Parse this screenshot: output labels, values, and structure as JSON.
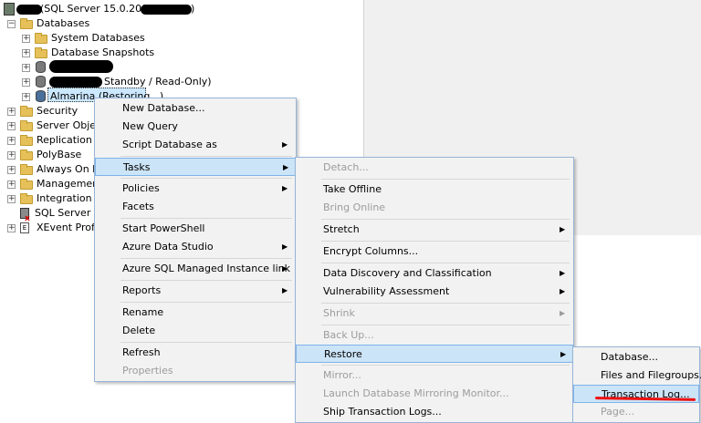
{
  "tree": {
    "server": {
      "prefix": "",
      "text": "(SQL Server 15.0.2000.5",
      "suffix": ")"
    },
    "databases": "Databases",
    "system_databases": "System Databases",
    "database_snapshots": "Database Snapshots",
    "standby_db_suffix": "Standby / Read-Only)",
    "restoring_db": "Almarina (Restoring...)",
    "security": "Security",
    "server_objects": "Server Objects",
    "replication": "Replication",
    "polybase": "PolyBase",
    "always_on": "Always On Hi",
    "management": "Management",
    "integration": "Integration Se",
    "agent": "SQL Server Ag",
    "xevent": "XEvent Profile"
  },
  "context_menu": {
    "new_database": "New Database...",
    "new_query": "New Query",
    "script_database_as": "Script Database as",
    "tasks": "Tasks",
    "policies": "Policies",
    "facets": "Facets",
    "start_powershell": "Start PowerShell",
    "azure_data_studio": "Azure Data Studio",
    "azure_sql_mi_link": "Azure SQL Managed Instance link",
    "reports": "Reports",
    "rename": "Rename",
    "delete": "Delete",
    "refresh": "Refresh",
    "properties": "Properties"
  },
  "tasks_menu": {
    "detach": "Detach...",
    "take_offline": "Take Offline",
    "bring_online": "Bring Online",
    "stretch": "Stretch",
    "encrypt_columns": "Encrypt Columns...",
    "data_discovery": "Data Discovery and Classification",
    "vulnerability": "Vulnerability Assessment",
    "shrink": "Shrink",
    "back_up": "Back Up...",
    "restore": "Restore",
    "mirror": "Mirror...",
    "launch_mirroring": "Launch Database Mirroring Monitor...",
    "ship_logs": "Ship Transaction Logs..."
  },
  "restore_menu": {
    "database": "Database...",
    "files_filegroups": "Files and Filegroups...",
    "transaction_log": "Transaction Log...",
    "page": "Page..."
  },
  "colors": {
    "menu_bg": "#f2f2f2",
    "highlight": "#cce4f7",
    "highlight_border": "#7eb4ea",
    "annotation": "#e11111"
  }
}
